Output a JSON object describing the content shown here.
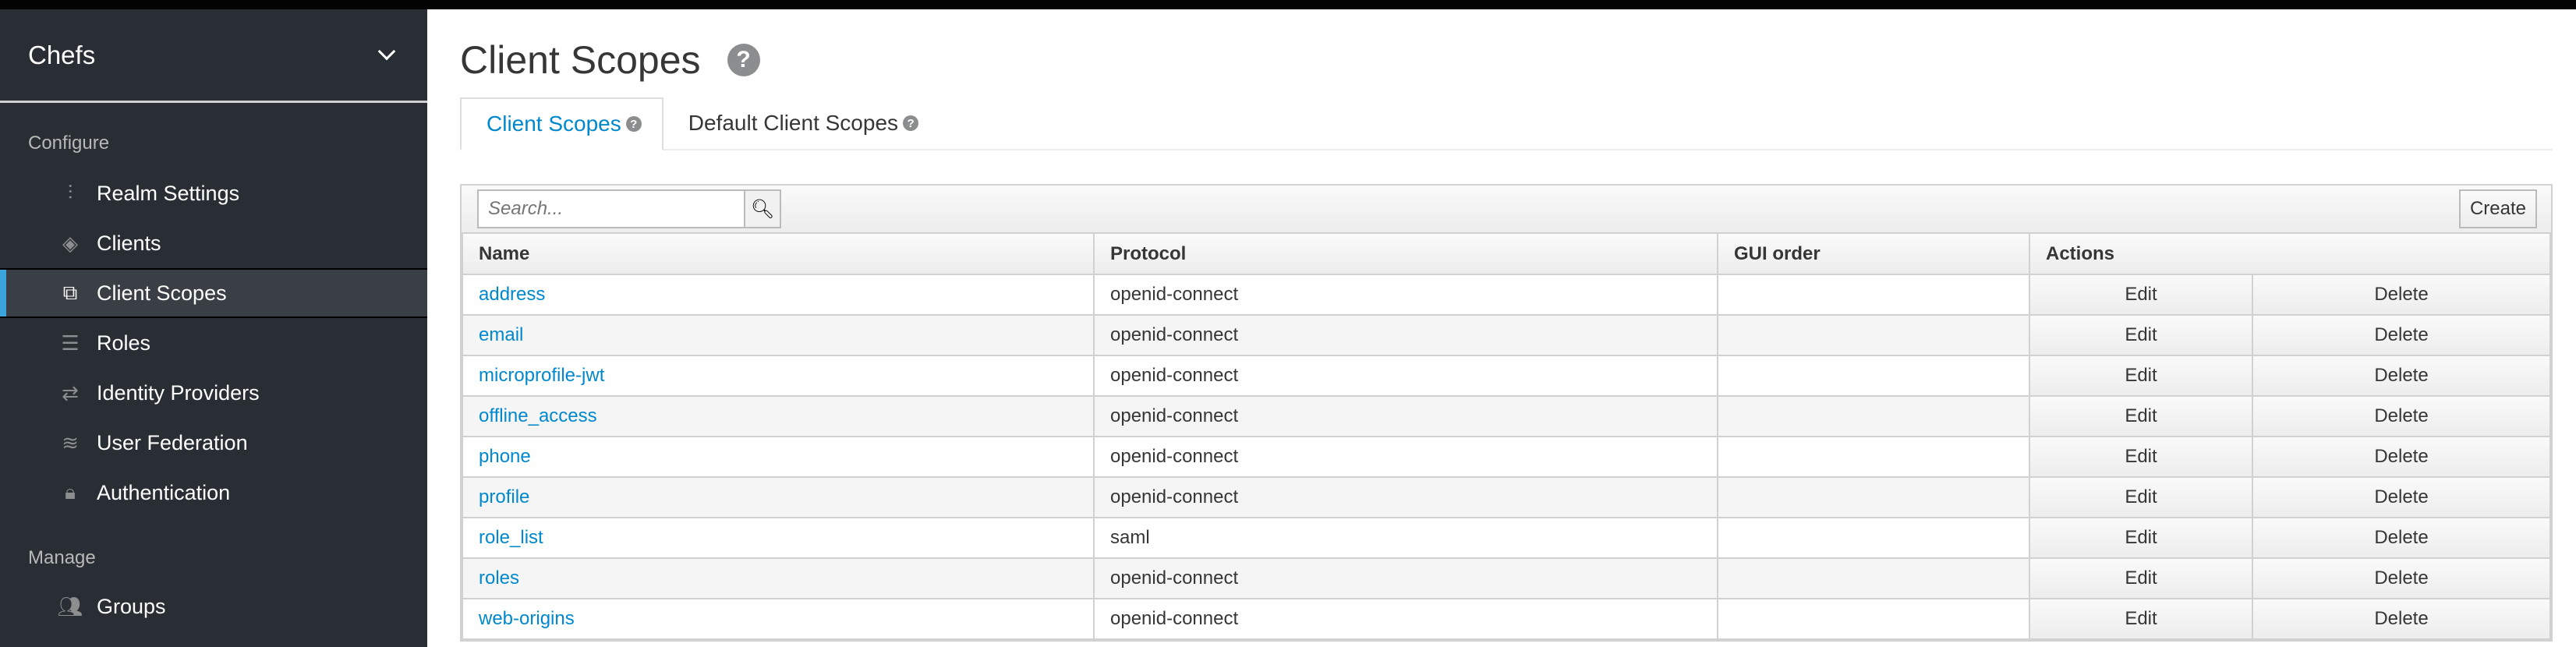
{
  "sidebar": {
    "realm": "Chefs",
    "configure_label": "Configure",
    "manage_label": "Manage",
    "configure_items": [
      {
        "label": "Realm Settings",
        "icon": "sliders-icon"
      },
      {
        "label": "Clients",
        "icon": "cube-icon"
      },
      {
        "label": "Client Scopes",
        "icon": "cubes-icon",
        "active": true
      },
      {
        "label": "Roles",
        "icon": "server-icon"
      },
      {
        "label": "Identity Providers",
        "icon": "exchange-icon"
      },
      {
        "label": "User Federation",
        "icon": "database-icon"
      },
      {
        "label": "Authentication",
        "icon": "lock-icon"
      }
    ],
    "manage_items": [
      {
        "label": "Groups",
        "icon": "users-icon"
      }
    ]
  },
  "page": {
    "title": "Client Scopes",
    "tabs": [
      {
        "label": "Client Scopes",
        "active": true
      },
      {
        "label": "Default Client Scopes"
      }
    ]
  },
  "toolbar": {
    "search_placeholder": "Search...",
    "create_label": "Create"
  },
  "table": {
    "headers": [
      "Name",
      "Protocol",
      "GUI order",
      "Actions"
    ],
    "edit_label": "Edit",
    "delete_label": "Delete",
    "rows": [
      {
        "name": "address",
        "protocol": "openid-connect",
        "gui_order": ""
      },
      {
        "name": "email",
        "protocol": "openid-connect",
        "gui_order": ""
      },
      {
        "name": "microprofile-jwt",
        "protocol": "openid-connect",
        "gui_order": ""
      },
      {
        "name": "offline_access",
        "protocol": "openid-connect",
        "gui_order": ""
      },
      {
        "name": "phone",
        "protocol": "openid-connect",
        "gui_order": ""
      },
      {
        "name": "profile",
        "protocol": "openid-connect",
        "gui_order": ""
      },
      {
        "name": "role_list",
        "protocol": "saml",
        "gui_order": ""
      },
      {
        "name": "roles",
        "protocol": "openid-connect",
        "gui_order": ""
      },
      {
        "name": "web-origins",
        "protocol": "openid-connect",
        "gui_order": ""
      }
    ]
  },
  "colors": {
    "accent": "#0088ce",
    "sidebar_bg": "#292e34",
    "active_marker": "#39a5dc"
  }
}
